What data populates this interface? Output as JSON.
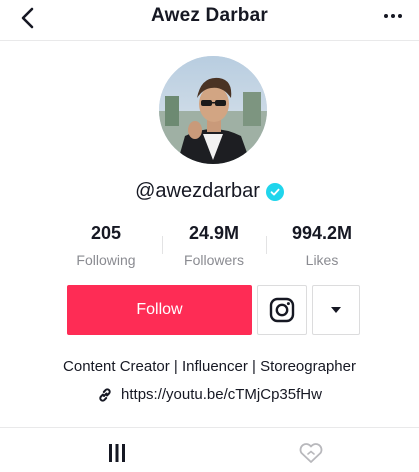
{
  "header": {
    "title": "Awez Darbar",
    "back_icon": "chevron-left-icon",
    "more_icon": "more-horizontal-icon"
  },
  "profile": {
    "avatar_icon": "profile-avatar",
    "username": "@awezdarbar",
    "verified_icon": "verified-badge-icon",
    "verified_color": "#20d5ec"
  },
  "stats": [
    {
      "value": "205",
      "label": "Following"
    },
    {
      "value": "24.9M",
      "label": "Followers"
    },
    {
      "value": "994.2M",
      "label": "Likes"
    }
  ],
  "actions": {
    "follow_label": "Follow",
    "follow_color": "#fe2c55",
    "instagram_icon": "instagram-icon",
    "dropdown_icon": "triangle-down-icon"
  },
  "bio": {
    "text": "Content Creator | Influencer | Storeographer",
    "link_icon": "link-icon",
    "link": "https://youtu.be/cTMjCp35fHw"
  },
  "tabs": [
    {
      "icon": "videos-grid-icon"
    },
    {
      "icon": "liked-videos-icon"
    }
  ]
}
